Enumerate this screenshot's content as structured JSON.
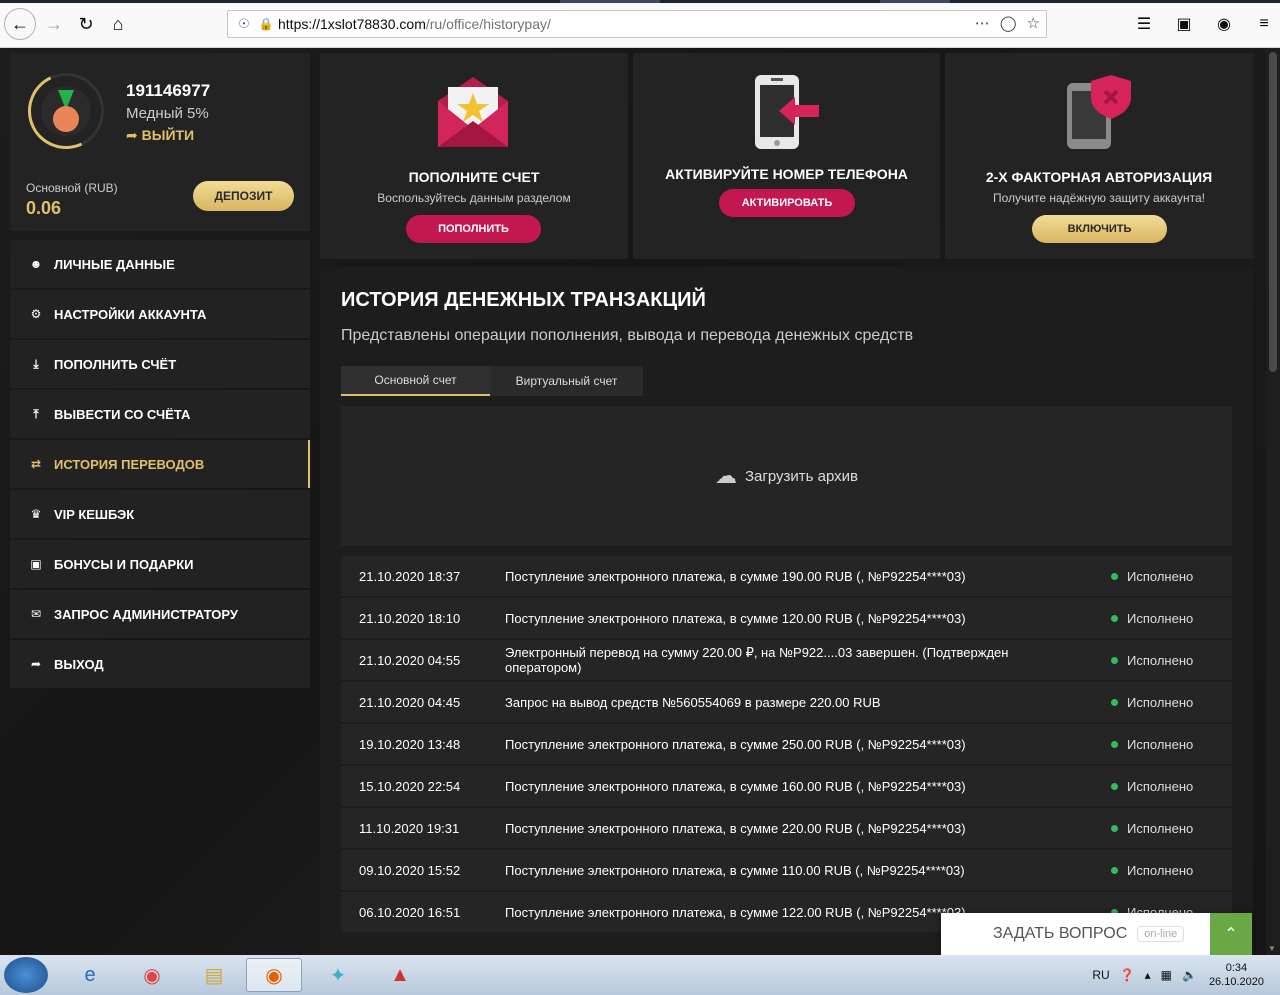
{
  "browser": {
    "url_host": "https://1xslot78830.com",
    "url_path": "/ru/office/historypay/"
  },
  "profile": {
    "user_id": "191146977",
    "level": "Медный 5%",
    "logout": "ВЫЙТИ",
    "balance_label": "Основной (RUB)",
    "balance_value": "0.06",
    "deposit_button": "ДЕПОЗИТ"
  },
  "menu": [
    {
      "label": "ЛИЧНЫЕ ДАННЫЕ",
      "icon": "user-plus-icon"
    },
    {
      "label": "НАСТРОЙКИ АККАУНТА",
      "icon": "gears-icon"
    },
    {
      "label": "ПОПОЛНИТЬ СЧЁТ",
      "icon": "download-icon"
    },
    {
      "label": "ВЫВЕСТИ СО СЧЁТА",
      "icon": "upload-icon"
    },
    {
      "label": "ИСТОРИЯ ПЕРЕВОДОВ",
      "icon": "transfer-icon",
      "active": true
    },
    {
      "label": "VIP КЕШБЭК",
      "icon": "crown-icon"
    },
    {
      "label": "БОНУСЫ И ПОДАРКИ",
      "icon": "gift-icon"
    },
    {
      "label": "ЗАПРОС АДМИНИСТРАТОРУ",
      "icon": "envelope-icon"
    },
    {
      "label": "ВЫХОД",
      "icon": "exit-icon"
    }
  ],
  "cards": {
    "deposit": {
      "title": "ПОПОЛНИТЕ СЧЕТ",
      "subtitle": "Воспользуйтесь данным разделом",
      "button": "ПОПОЛНИТЬ"
    },
    "phone": {
      "title": "АКТИВИРУЙТЕ НОМЕР ТЕЛЕФОНА",
      "button": "АКТИВИРОВАТЬ"
    },
    "twofa": {
      "title": "2-Х ФАКТОРНАЯ АВТОРИЗАЦИЯ",
      "subtitle": "Получите надёжную защиту аккаунта!",
      "button": "ВКЛЮЧИТЬ"
    }
  },
  "history": {
    "title": "ИСТОРИЯ ДЕНЕЖНЫХ ТРАНЗАКЦИЙ",
    "description": "Представлены операции пополнения, вывода и перевода денежных средств",
    "tabs": [
      "Основной счет",
      "Виртуальный счет"
    ],
    "archive": "Загрузить архив",
    "rows": [
      {
        "date": "21.10.2020 18:37",
        "text": "Поступление электронного платежа, в сумме 190.00 RUB (, №P92254****03)",
        "status": "Исполнено"
      },
      {
        "date": "21.10.2020 18:10",
        "text": "Поступление электронного платежа, в сумме 120.00 RUB (, №P92254****03)",
        "status": "Исполнено"
      },
      {
        "date": "21.10.2020 04:55",
        "text": "Электронный перевод на сумму 220.00 ₽, на №P922....03 завершен. (Подтвержден оператором)",
        "status": "Исполнено"
      },
      {
        "date": "21.10.2020 04:45",
        "text": "Запрос на вывод средств №560554069 в размере 220.00 RUB",
        "status": "Исполнено"
      },
      {
        "date": "19.10.2020 13:48",
        "text": "Поступление электронного платежа, в сумме 250.00 RUB (, №P92254****03)",
        "status": "Исполнено"
      },
      {
        "date": "15.10.2020 22:54",
        "text": "Поступление электронного платежа, в сумме 160.00 RUB (, №P92254****03)",
        "status": "Исполнено"
      },
      {
        "date": "11.10.2020 19:31",
        "text": "Поступление электронного платежа, в сумме 220.00 RUB (, №P92254****03)",
        "status": "Исполнено"
      },
      {
        "date": "09.10.2020 15:52",
        "text": "Поступление электронного платежа, в сумме 110.00 RUB (, №P92254****03)",
        "status": "Исполнено"
      },
      {
        "date": "06.10.2020 16:51",
        "text": "Поступление электронного платежа, в сумме 122.00 RUB (, №P92254****03)",
        "status": "Исполнено"
      }
    ]
  },
  "chat": {
    "label": "ЗАДАТЬ ВОПРОС",
    "status": "on-line"
  },
  "taskbar": {
    "lang": "RU",
    "time": "0:34",
    "date": "26.10.2020"
  }
}
